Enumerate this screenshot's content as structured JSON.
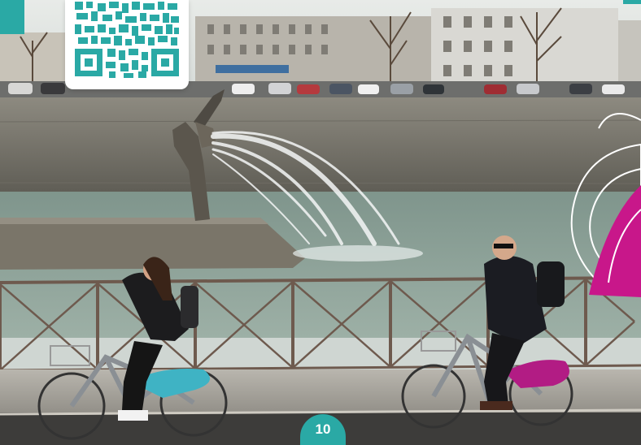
{
  "page": {
    "number": "10"
  },
  "colors": {
    "accent_teal": "#2aa9a5",
    "accent_magenta": "#c8178a",
    "water": "#8fa39a",
    "railing": "#6e5a4e"
  },
  "scene": {
    "description_icons": [
      "qr-code-icon",
      "monstera-leaf-icon"
    ]
  }
}
